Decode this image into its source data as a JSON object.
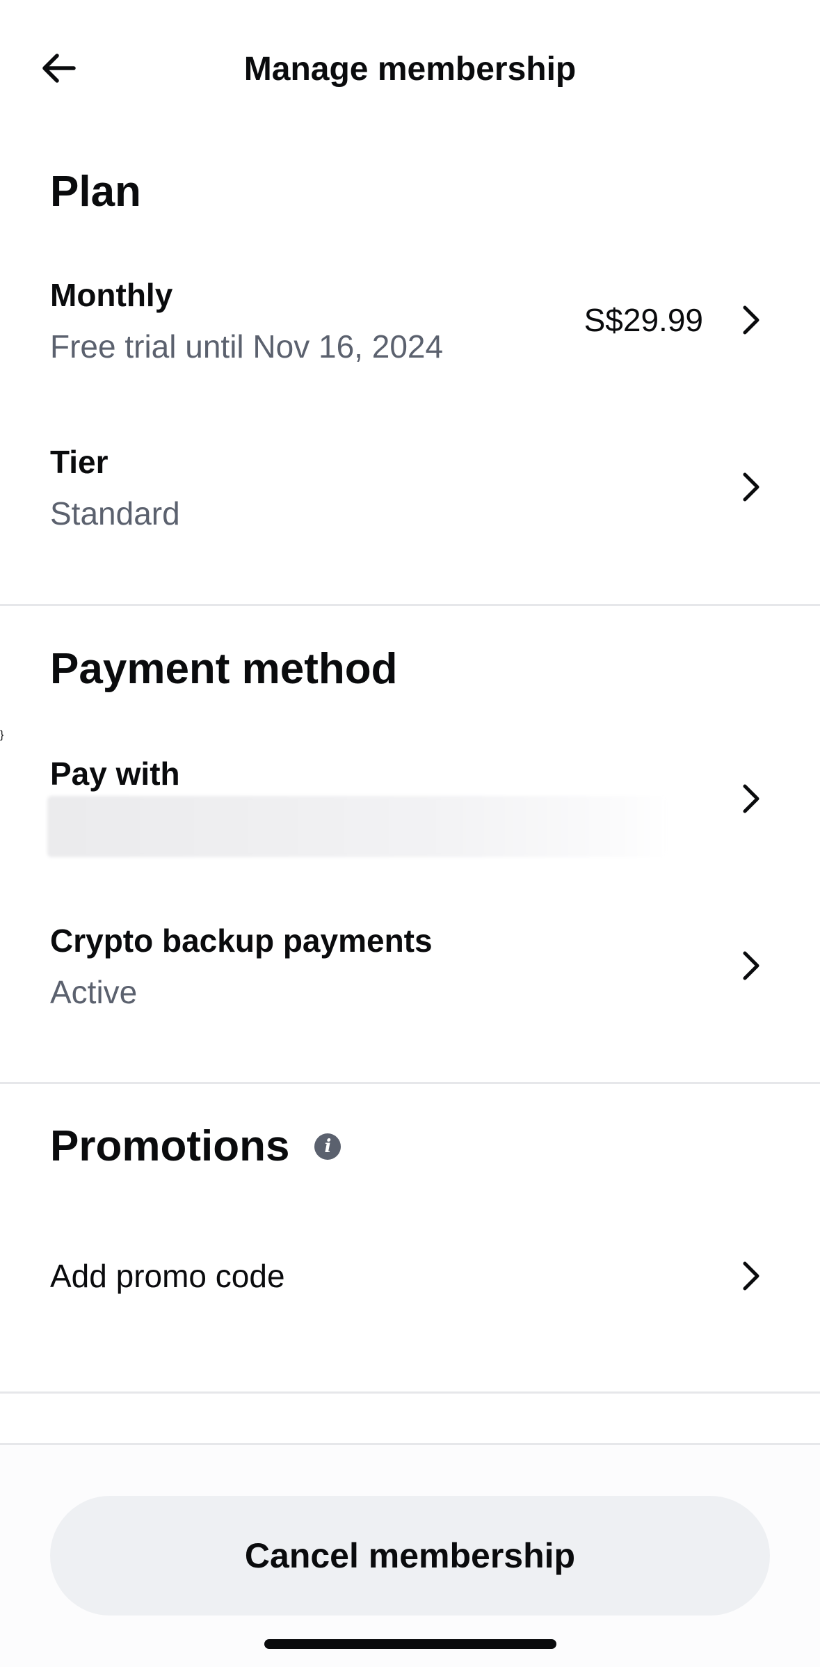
{
  "header": {
    "title": "Manage membership",
    "back_icon": "arrow-left-icon"
  },
  "plan": {
    "title": "Plan",
    "monthly": {
      "label": "Monthly",
      "sub": "Free trial until Nov 16, 2024",
      "price": "S$29.99"
    },
    "tier": {
      "label": "Tier",
      "sub": "Standard"
    }
  },
  "payment": {
    "title": "Payment method",
    "pay_with": {
      "label": "Pay with"
    },
    "crypto_backup": {
      "label": "Crypto backup payments",
      "sub": "Active"
    }
  },
  "promotions": {
    "title": "Promotions",
    "info_icon": "info-icon",
    "add_promo": {
      "label": "Add promo code"
    }
  },
  "footer": {
    "cancel_label": "Cancel membership"
  },
  "colors": {
    "text_primary": "#0a0b0d",
    "text_secondary": "#5b616e",
    "divider": "#e6e7ea",
    "button_bg": "#eef0f3"
  }
}
